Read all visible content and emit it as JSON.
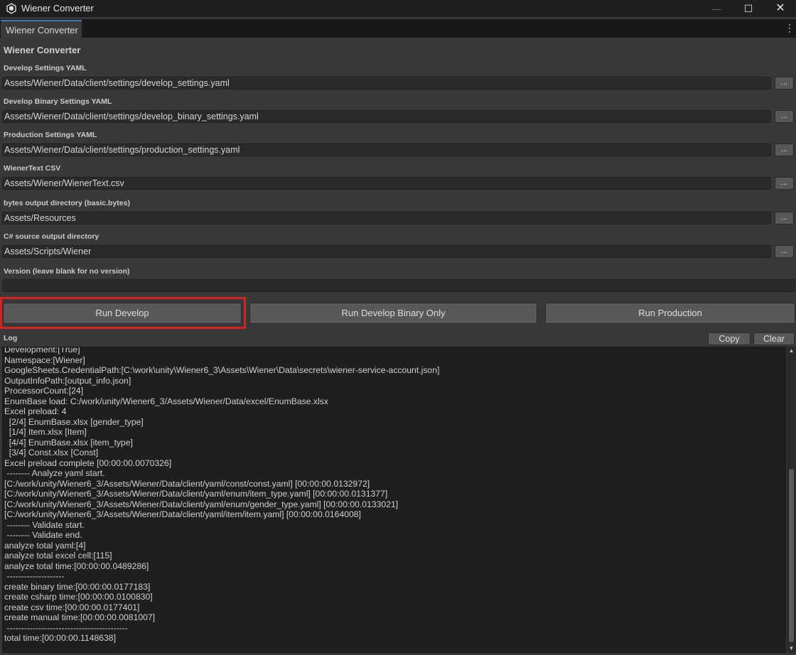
{
  "window": {
    "title": "Wiener Converter",
    "minimize": "—",
    "maximize": "☐",
    "close": "✕"
  },
  "tab": {
    "label": "Wiener Converter",
    "menu": "⋮"
  },
  "section_title": "Wiener Converter",
  "fields": [
    {
      "label": "Develop Settings YAML",
      "value": "Assets/Wiener/Data/client/settings/develop_settings.yaml",
      "button": "..."
    },
    {
      "label": "Develop Binary Settings YAML",
      "value": "Assets/Wiener/Data/client/settings/develop_binary_settings.yaml",
      "button": "..."
    },
    {
      "label": "Production Settings YAML",
      "value": "Assets/Wiener/Data/client/settings/production_settings.yaml",
      "button": "..."
    },
    {
      "label": "WienerText CSV",
      "value": "Assets/Wiener/WienerText.csv",
      "button": "..."
    },
    {
      "label": "bytes output directory (basic.bytes)",
      "value": "Assets/Resources",
      "button": "..."
    },
    {
      "label": "C# source output directory",
      "value": "Assets/Scripts/Wiener",
      "button": "..."
    }
  ],
  "version": {
    "label": "Version (leave blank for no version)",
    "value": ""
  },
  "buttons": {
    "run_develop": "Run Develop",
    "run_develop_binary": "Run Develop Binary Only",
    "run_production": "Run Production",
    "copy": "Copy",
    "clear": "Clear"
  },
  "log": {
    "label": "Log",
    "lines": [
      "Development:[True]",
      "Namespace:[Wiener]",
      "GoogleSheets.CredentialPath:[C:\\work\\unity\\Wiener6_3\\Assets\\Wiener\\Data\\secrets\\wiener-service-account.json]",
      "OutputInfoPath:[output_info.json]",
      "ProcessorCount:[24]",
      "EnumBase load: C:/work/unity/Wiener6_3/Assets/Wiener/Data/excel/EnumBase.xlsx",
      "Excel preload: 4",
      "  [2/4] EnumBase.xlsx [gender_type]",
      "  [1/4] Item.xlsx [Item]",
      "  [4/4] EnumBase.xlsx [item_type]",
      "  [3/4] Const.xlsx [Const]",
      "Excel preload complete [00:00:00.0070326]",
      " -------- Analyze yaml start.",
      "[C:/work/unity/Wiener6_3/Assets/Wiener/Data/client/yaml/const/const.yaml] [00:00:00.0132972]",
      "[C:/work/unity/Wiener6_3/Assets/Wiener/Data/client/yaml/enum/item_type.yaml] [00:00:00.0131377]",
      "[C:/work/unity/Wiener6_3/Assets/Wiener/Data/client/yaml/enum/gender_type.yaml] [00:00:00.0133021]",
      "[C:/work/unity/Wiener6_3/Assets/Wiener/Data/client/yaml/item/item.yaml] [00:00:00.0164008]",
      " -------- Validate start.",
      " -------- Validate end.",
      "analyze total yaml:[4]",
      "analyze total excel cell:[115]",
      "analyze total time:[00:00:00.0489286]",
      " --------------------",
      "create binary time:[00:00:00.0177183]",
      "create csharp time:[00:00:00.0100830]",
      "create csv time:[00:00:00.0177401]",
      "create manual time:[00:00:00.0081007]",
      " ------------------------------------------",
      "total time:[00:00:00.1148638]"
    ]
  },
  "colors": {
    "background": "#383838",
    "highlight": "#d42323",
    "tab_accent": "#3a79bb",
    "log_background": "#1f1f1f"
  }
}
